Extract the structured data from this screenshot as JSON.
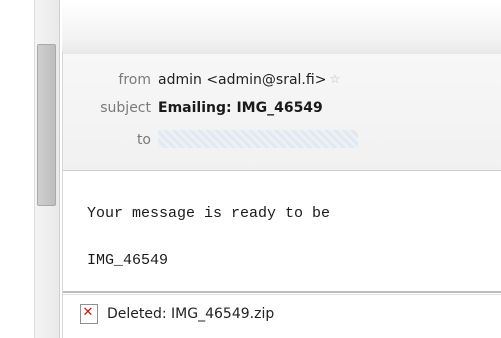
{
  "header": {
    "from_label": "from",
    "from_value": "admin <admin@sral.fi>",
    "subject_label": "subject",
    "subject_value": "Emailing: IMG_46549",
    "to_label": "to"
  },
  "body": {
    "line1": "Your message is ready to be",
    "line2": "IMG_46549"
  },
  "attachment": {
    "label": "Deleted: IMG_46549.zip",
    "icon": "deleted-file-icon"
  }
}
